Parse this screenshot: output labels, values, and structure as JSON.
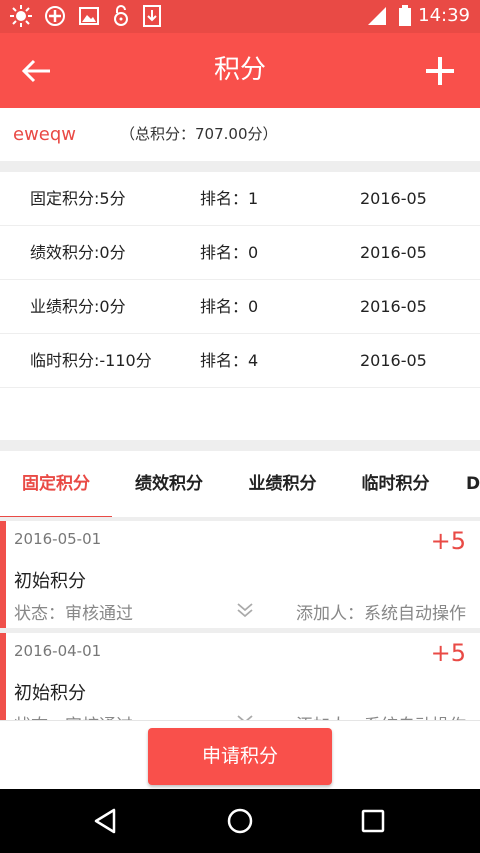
{
  "status_bar": {
    "time": "14:39",
    "icons": [
      "brightness-icon",
      "gps-icon",
      "image-icon",
      "unlock-icon",
      "download-icon",
      "signal-icon",
      "battery-icon"
    ]
  },
  "app_bar": {
    "title": "积分",
    "back_icon": "back-arrow-icon",
    "add_icon": "plus-icon",
    "color": "#f9504b"
  },
  "user": {
    "name": "eweqw",
    "total": "（总积分：707.00分）"
  },
  "summary": [
    {
      "label": "固定积分:5分",
      "rank": "排名：1",
      "date": "2016-05"
    },
    {
      "label": "绩效积分:0分",
      "rank": "排名：0",
      "date": "2016-05"
    },
    {
      "label": "业绩积分:0分",
      "rank": "排名：0",
      "date": "2016-05"
    },
    {
      "label": "临时积分:-110分",
      "rank": "排名：4",
      "date": "2016-05"
    }
  ],
  "tabs": [
    {
      "label": "固定积分",
      "active": true
    },
    {
      "label": "绩效积分",
      "active": false
    },
    {
      "label": "业绩积分",
      "active": false
    },
    {
      "label": "临时积分",
      "active": false
    },
    {
      "label": "D",
      "active": false
    }
  ],
  "records": [
    {
      "date": "2016-05-01",
      "points": "+5",
      "name": "初始积分",
      "status": "状态：审核通过",
      "adder": "添加人：系统自动操作"
    },
    {
      "date": "2016-04-01",
      "points": "+5",
      "name": "初始积分",
      "status": "状态：审核通过",
      "adder": "添加人：系统自动操作"
    }
  ],
  "apply_button": "申请积分",
  "nav_bar": {
    "back": "nav-back-icon",
    "home": "nav-home-icon",
    "recent": "nav-recent-icon"
  },
  "colors": {
    "accent": "#e94a45",
    "divider": "#eeeeee"
  }
}
